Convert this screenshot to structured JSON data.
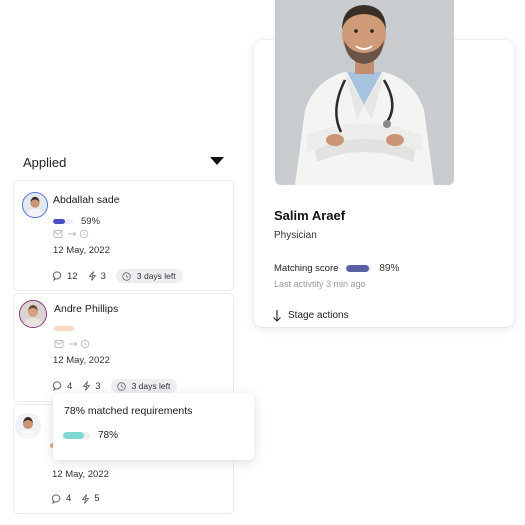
{
  "profile": {
    "name": "Salim Araef",
    "role": "Physician",
    "match_label": "Matching score",
    "match_score": 89,
    "match_display": "89%",
    "last_activity": "Last activtity 3 min ago",
    "stage_actions": "Stage actions",
    "match_color": "#5b5fa6"
  },
  "column": {
    "title": "Applied",
    "toggle_icon": "caret-down-icon"
  },
  "candidates": [
    {
      "name": "Abdallah sade",
      "progress": 59,
      "progress_display": "59%",
      "progress_color": "#4a4fc4",
      "date": "12 May, 2022",
      "comments": "12",
      "activity": "3",
      "days_left": "3 days left"
    },
    {
      "name": "Andre Phillips",
      "progress": 0,
      "progress_display": "",
      "progress_color": "#f9c9a4",
      "date": "12 May, 2022",
      "comments": "4",
      "activity": "3",
      "days_left": "3 days left"
    },
    {
      "name": "",
      "progress": 0,
      "progress_display": "",
      "progress_color": "#f2a27d",
      "date": "12 May, 2022",
      "comments": "4",
      "activity": "5",
      "days_left": ""
    }
  ],
  "tooltip": {
    "text": "78% matched requirements",
    "value": 78,
    "value_display": "78%",
    "color": "#7fd8cf"
  }
}
